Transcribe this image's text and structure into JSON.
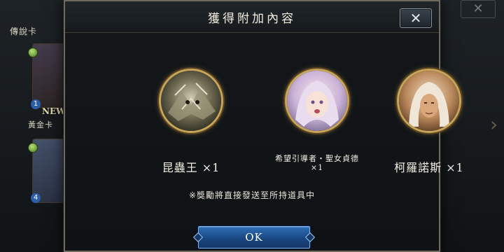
{
  "background": {
    "section_label_1": "傳說卡",
    "section_label_2": "黃金卡",
    "new_badge": "NEW",
    "card_costs": [
      "1",
      "4"
    ],
    "close_glyph": "✕"
  },
  "dialog": {
    "title": "獲得附加內容",
    "close_icon": "close-x-icon",
    "rewards": [
      {
        "name": "昆蟲王",
        "qty": "×1",
        "portrait": "insect-king-portrait"
      },
      {
        "name": "希望引導者・聖女貞德",
        "qty": "×1",
        "portrait": "saint-joan-portrait"
      },
      {
        "name": "柯羅諾斯",
        "qty": "×1",
        "portrait": "chronos-portrait"
      }
    ],
    "notice": "※獎勵將直接發送至所持道具中",
    "ok_label": "OK"
  },
  "colors": {
    "frame_gold": "#c7a55a",
    "button_blue": "#1a4782",
    "panel_dark": "#14181b"
  }
}
